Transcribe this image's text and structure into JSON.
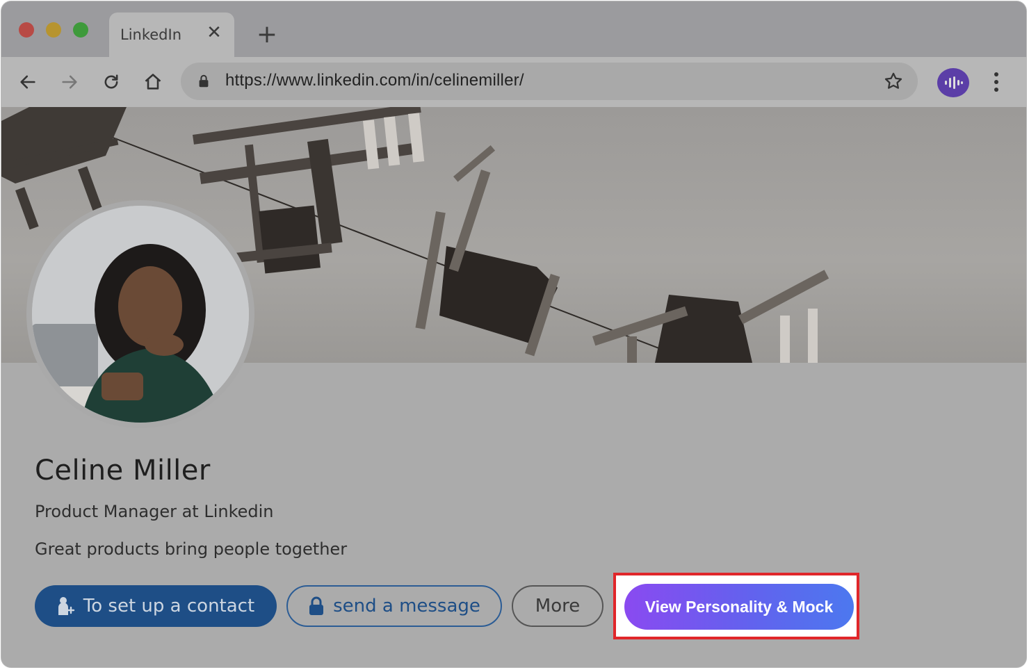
{
  "browser": {
    "tab_title": "LinkedIn",
    "tab_close": "✕",
    "new_tab": "+",
    "url": "https://www.linkedin.com/in/celinemiller/"
  },
  "profile": {
    "name": "Celine Miller",
    "headline": "Product Manager at Linkedin",
    "tagline": "Great products bring people together"
  },
  "actions": {
    "contact_label": "To set up a contact",
    "message_label": "send a message",
    "more_label": "More",
    "view_label": "View Personality & Mock"
  },
  "colors": {
    "contact_button": "#1e4e86",
    "view_button_gradient_start": "#8a4af0",
    "view_button_gradient_end": "#4c78ef",
    "highlight_border": "#e0262a",
    "extension_icon": "#5b3ea7"
  }
}
